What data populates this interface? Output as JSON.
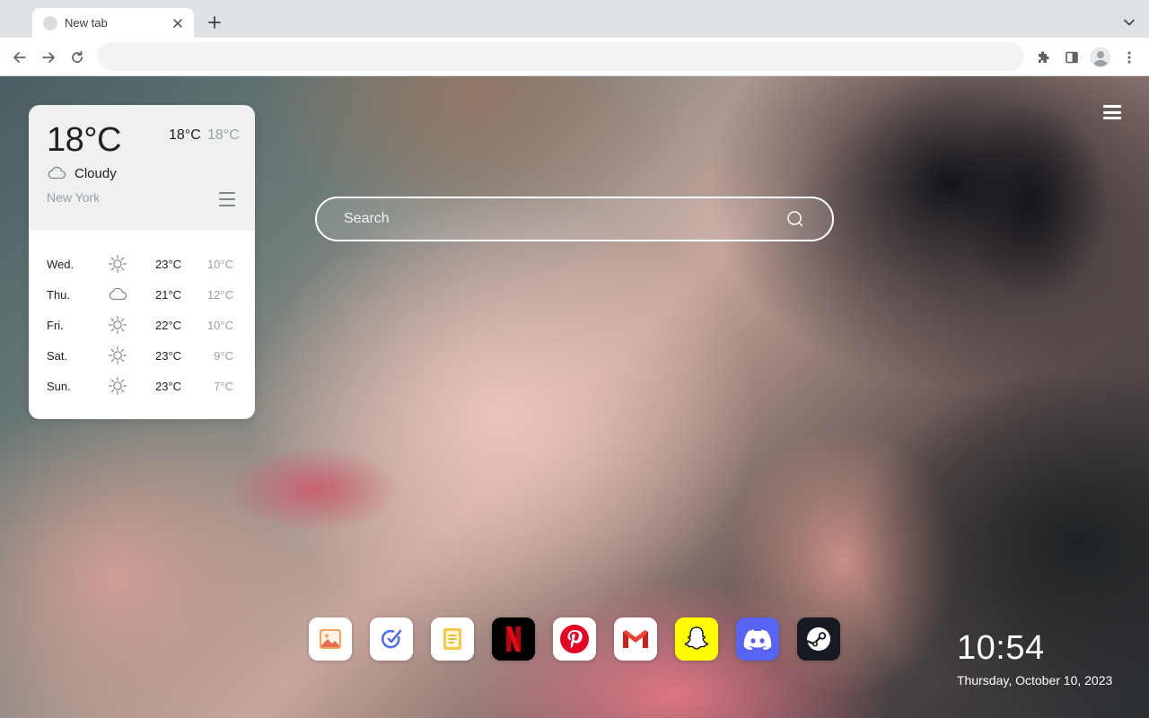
{
  "browser": {
    "tab_title": "New tab",
    "address_value": "",
    "address_placeholder": ""
  },
  "weather": {
    "current_temp": "18°C",
    "today_high": "18°C",
    "today_low": "18°C",
    "condition": "Cloudy",
    "condition_icon": "cloud-icon",
    "city": "New York",
    "forecast": [
      {
        "day": "Wed.",
        "icon": "sun-icon",
        "high": "23°C",
        "low": "10°C"
      },
      {
        "day": "Thu.",
        "icon": "cloud-icon",
        "high": "21°C",
        "low": "12°C"
      },
      {
        "day": "Fri.",
        "icon": "sun-icon",
        "high": "22°C",
        "low": "10°C"
      },
      {
        "day": "Sat.",
        "icon": "sun-icon",
        "high": "23°C",
        "low": "9°C"
      },
      {
        "day": "Sun.",
        "icon": "sun-icon",
        "high": "23°C",
        "low": "7°C"
      }
    ]
  },
  "search": {
    "placeholder": "Search",
    "value": ""
  },
  "dock": {
    "apps": [
      {
        "name": "photos-app",
        "icon": "image-icon",
        "bg": "#ffffff"
      },
      {
        "name": "tasks-app",
        "icon": "check-pen-icon",
        "bg": "#ffffff"
      },
      {
        "name": "notes-app",
        "icon": "notepad-icon",
        "bg": "#ffffff"
      },
      {
        "name": "netflix-app",
        "icon": "netflix-icon",
        "bg": "#000000"
      },
      {
        "name": "pinterest-app",
        "icon": "pinterest-icon",
        "bg": "#ffffff"
      },
      {
        "name": "gmail-app",
        "icon": "gmail-icon",
        "bg": "#ffffff"
      },
      {
        "name": "snapchat-app",
        "icon": "snapchat-icon",
        "bg": "#fffc00"
      },
      {
        "name": "discord-app",
        "icon": "discord-icon",
        "bg": "#5865f2"
      },
      {
        "name": "steam-app",
        "icon": "steam-icon",
        "bg": "#171a21"
      }
    ]
  },
  "clock": {
    "time": "10:54",
    "date": "Thursday, October 10, 2023"
  },
  "colors": {
    "netflix_red": "#e50914",
    "pinterest_red": "#e60023",
    "snapchat_yellow": "#fffc00",
    "discord_blurple": "#5865f2",
    "tab_strip": "#dee1e6"
  }
}
